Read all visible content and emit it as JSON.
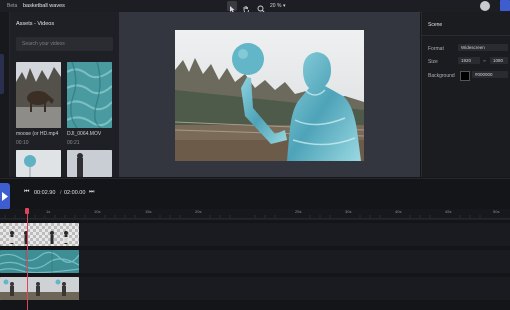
{
  "topbar": {
    "logo": "Beta",
    "project_title": "basketball waves",
    "zoom": "20 %",
    "tools": [
      "select-icon",
      "hand-icon",
      "zoom-icon"
    ]
  },
  "assets": {
    "title": "Assets - Videos",
    "search_placeholder": "Search your videos",
    "items": [
      {
        "name": "moose (or HD.mp4",
        "duration": "00:10"
      },
      {
        "name": "DJI_0064.MOV",
        "duration": "00:21"
      }
    ]
  },
  "inspector": {
    "title": "Scene",
    "format_label": "Format",
    "format_value": "Widescreen",
    "size_label": "Size",
    "width": "1920",
    "height": "1080",
    "background_label": "Background",
    "background_value": "#000000"
  },
  "playback": {
    "current": "00:02.90",
    "separator": "/",
    "total": "02:00.00"
  },
  "ruler": {
    "labels": [
      "1s",
      "10s",
      "15s",
      "20s",
      "25s",
      "30s",
      "40s",
      "45s",
      "50s"
    ]
  },
  "colors": {
    "accent": "#3e5ecf",
    "playhead": "#e0445a"
  }
}
